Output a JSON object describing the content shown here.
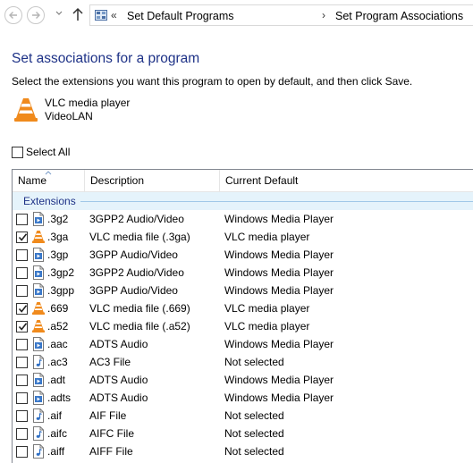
{
  "address": {
    "overflow": "«",
    "separator": "›",
    "crumbs": [
      "Set Default Programs",
      "Set Program Associations"
    ]
  },
  "page": {
    "title": "Set associations for a program",
    "instruction": "Select the extensions you want this program to open by default, and then click Save."
  },
  "program": {
    "name": "VLC media player",
    "vendor": "VideoLAN"
  },
  "select_all": {
    "label": "Select All",
    "checked": false
  },
  "columns": [
    "Name",
    "Description",
    "Current Default"
  ],
  "group": {
    "label": "Extensions"
  },
  "rows": [
    {
      "ext": ".3g2",
      "desc": "3GPP2 Audio/Video",
      "default": "Windows Media Player",
      "checked": false,
      "icon": "video-file-icon"
    },
    {
      "ext": ".3ga",
      "desc": "VLC media file (.3ga)",
      "default": "VLC media player",
      "checked": true,
      "icon": "vlc-cone-icon"
    },
    {
      "ext": ".3gp",
      "desc": "3GPP Audio/Video",
      "default": "Windows Media Player",
      "checked": false,
      "icon": "video-file-icon"
    },
    {
      "ext": ".3gp2",
      "desc": "3GPP2 Audio/Video",
      "default": "Windows Media Player",
      "checked": false,
      "icon": "video-file-icon"
    },
    {
      "ext": ".3gpp",
      "desc": "3GPP Audio/Video",
      "default": "Windows Media Player",
      "checked": false,
      "icon": "video-file-icon"
    },
    {
      "ext": ".669",
      "desc": "VLC media file (.669)",
      "default": "VLC media player",
      "checked": true,
      "icon": "vlc-cone-icon"
    },
    {
      "ext": ".a52",
      "desc": "VLC media file (.a52)",
      "default": "VLC media player",
      "checked": true,
      "icon": "vlc-cone-icon"
    },
    {
      "ext": ".aac",
      "desc": "ADTS Audio",
      "default": "Windows Media Player",
      "checked": false,
      "icon": "video-file-icon"
    },
    {
      "ext": ".ac3",
      "desc": "AC3 File",
      "default": "Not selected",
      "checked": false,
      "icon": "audio-file-icon"
    },
    {
      "ext": ".adt",
      "desc": "ADTS Audio",
      "default": "Windows Media Player",
      "checked": false,
      "icon": "video-file-icon"
    },
    {
      "ext": ".adts",
      "desc": "ADTS Audio",
      "default": "Windows Media Player",
      "checked": false,
      "icon": "video-file-icon"
    },
    {
      "ext": ".aif",
      "desc": "AIF File",
      "default": "Not selected",
      "checked": false,
      "icon": "audio-file-icon"
    },
    {
      "ext": ".aifc",
      "desc": "AIFC File",
      "default": "Not selected",
      "checked": false,
      "icon": "audio-file-icon"
    },
    {
      "ext": ".aiff",
      "desc": "AIFF File",
      "default": "Not selected",
      "checked": false,
      "icon": "audio-file-icon"
    }
  ],
  "colors": {
    "title": "#1e3287",
    "group_bg": "#e5f3fb",
    "vlc_orange": "#f08a1c"
  }
}
